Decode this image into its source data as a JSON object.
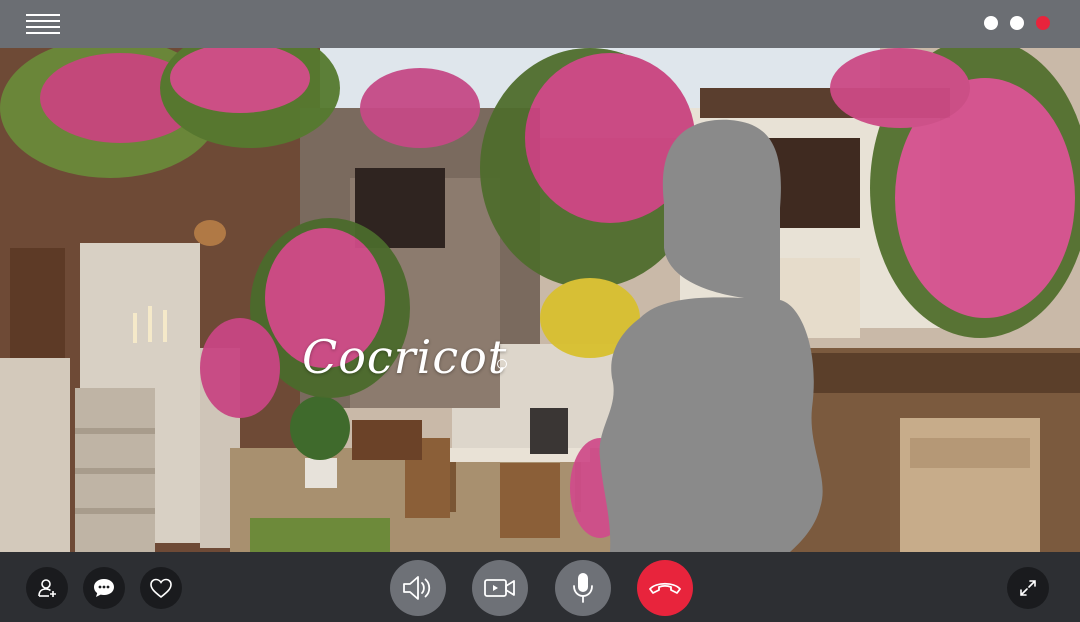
{
  "scene": {
    "logo_text": "Cocricot"
  },
  "topbar": {
    "menu_icon": "hamburger-menu-icon",
    "window_controls": [
      {
        "name": "white-dot",
        "color": "#ffffff"
      },
      {
        "name": "white-dot",
        "color": "#ffffff"
      },
      {
        "name": "red-dot",
        "color": "#e8243c"
      }
    ]
  },
  "controls": {
    "left": [
      "add-user-icon",
      "chat-bubble-icon",
      "heart-icon"
    ],
    "center": [
      "speaker-icon",
      "video-camera-icon",
      "microphone-icon",
      "hang-up-phone-icon"
    ],
    "right": [
      "expand-icon"
    ]
  },
  "colors": {
    "topbar": "#6b6e73",
    "bottombar": "#2d2f33",
    "end_call": "#e8243c",
    "silhouette": "#8a8a8a"
  }
}
